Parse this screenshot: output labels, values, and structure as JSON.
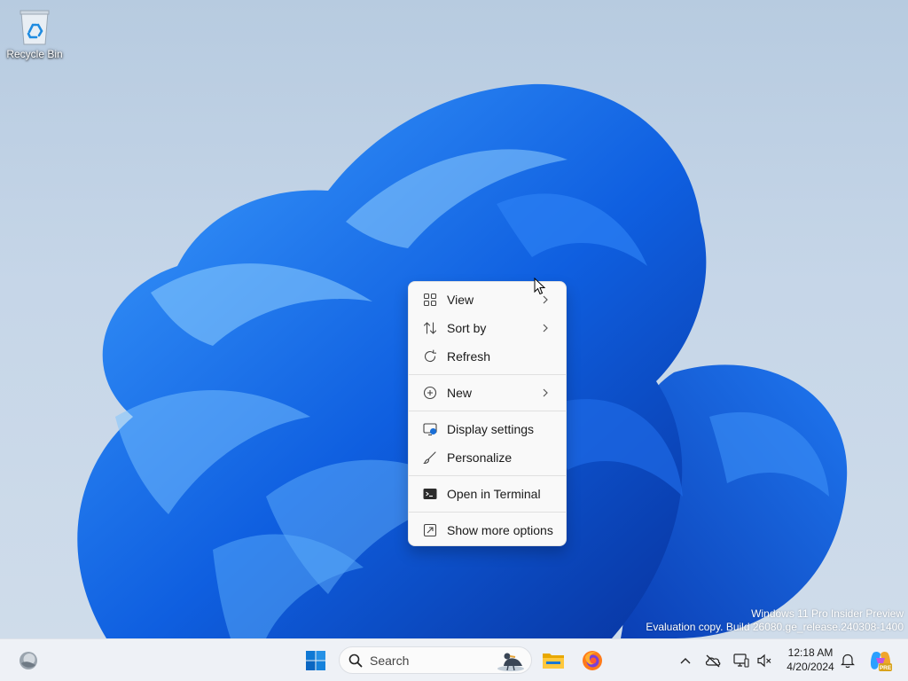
{
  "desktop": {
    "icons": [
      {
        "label": "Recycle Bin",
        "icon": "recycle-bin-icon"
      }
    ],
    "watermark": {
      "line1": "Windows 11 Pro Insider Preview",
      "line2": "Evaluation copy. Build 26080.ge_release.240308-1400"
    }
  },
  "context_menu": {
    "items": [
      {
        "label": "View",
        "icon": "view-grid-icon",
        "submenu": true
      },
      {
        "label": "Sort by",
        "icon": "sort-icon",
        "submenu": true
      },
      {
        "label": "Refresh",
        "icon": "refresh-icon",
        "submenu": false
      },
      {
        "label": "New",
        "icon": "new-plus-icon",
        "submenu": true
      },
      {
        "label": "Display settings",
        "icon": "display-settings-icon",
        "submenu": false
      },
      {
        "label": "Personalize",
        "icon": "brush-icon",
        "submenu": false
      },
      {
        "label": "Open in Terminal",
        "icon": "terminal-icon",
        "submenu": false
      },
      {
        "label": "Show more options",
        "icon": "show-more-icon",
        "submenu": false
      }
    ]
  },
  "taskbar": {
    "search_label": "Search",
    "apps": [
      "widgets-icon",
      "start-icon",
      "file-explorer-icon",
      "firefox-icon"
    ],
    "tray": {
      "icons": [
        "chevron-up-icon",
        "onedrive-offline-icon",
        "network-icon",
        "volume-muted-icon",
        "notifications-icon",
        "copilot-icon"
      ],
      "time": "12:18 AM",
      "date": "4/20/2024",
      "copilot_badge": "PRE"
    }
  },
  "colors": {
    "wallpaper_blue": "#1a6fe8",
    "menu_background": "#f9f9f9",
    "taskbar_background": "#eef1f6"
  }
}
